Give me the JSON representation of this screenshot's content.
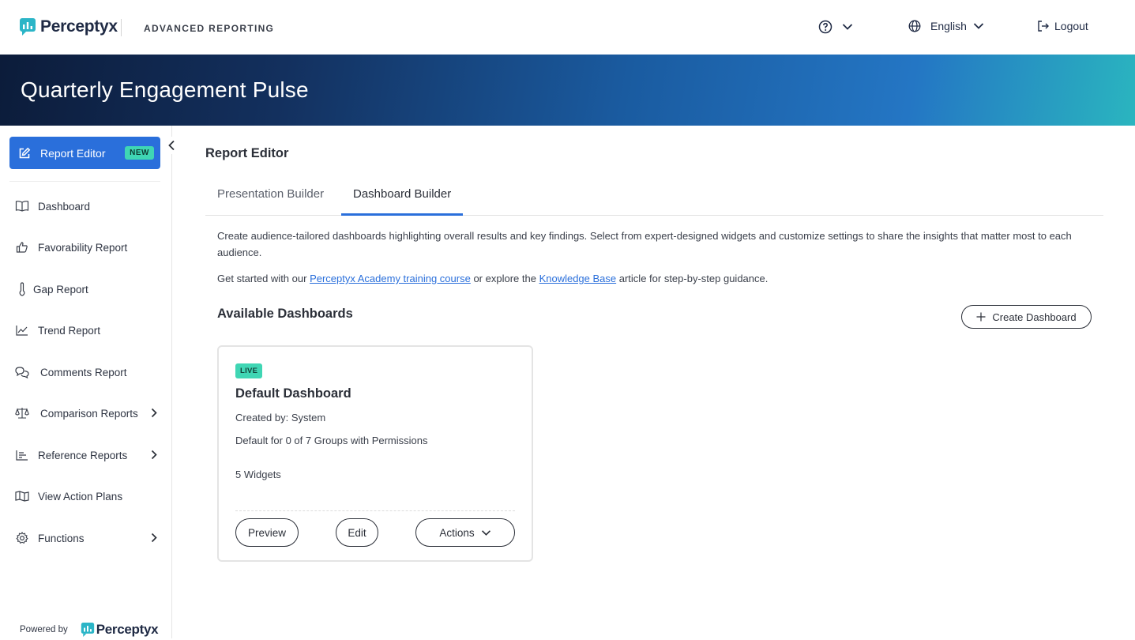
{
  "header": {
    "brand": "Perceptyx",
    "product": "ADVANCED REPORTING",
    "language": "English",
    "logout": "Logout"
  },
  "banner": {
    "title": "Quarterly Engagement Pulse"
  },
  "sidebar": {
    "active": {
      "label": "Report Editor",
      "badge": "NEW"
    },
    "items": [
      {
        "label": "Dashboard",
        "icon": "book-icon"
      },
      {
        "label": "Favorability Report",
        "icon": "thumbs-up-icon"
      },
      {
        "label": "Gap Report",
        "icon": "thermometer-icon"
      },
      {
        "label": "Trend Report",
        "icon": "line-chart-icon"
      },
      {
        "label": "Comments Report",
        "icon": "chat-bubbles-icon"
      },
      {
        "label": "Comparison Reports",
        "icon": "scale-icon"
      },
      {
        "label": "Reference Reports",
        "icon": "bar-list-icon"
      },
      {
        "label": "View Action Plans",
        "icon": "map-icon"
      },
      {
        "label": "Functions",
        "icon": "gear-icon"
      }
    ],
    "powered_by": "Powered by",
    "powered_brand": "Perceptyx"
  },
  "main": {
    "title": "Report Editor",
    "tabs": [
      {
        "label": "Presentation Builder"
      },
      {
        "label": "Dashboard Builder"
      }
    ],
    "description": "Create audience-tailored dashboards highlighting overall results and key findings. Select from expert-designed widgets and customize settings to share the insights that matter most to each audience.",
    "guide": {
      "prefix": "Get started with our ",
      "link1": "Perceptyx Academy training course",
      "middle": " or explore the ",
      "link2": "Knowledge Base",
      "suffix": " article for step-by-step guidance."
    },
    "available_title": "Available Dashboards",
    "create_label": "Create Dashboard",
    "card": {
      "status": "LIVE",
      "title": "Default Dashboard",
      "created_by": "Created by: System",
      "default_for": "Default for 0 of 7 Groups with Permissions",
      "widgets": "5 Widgets",
      "preview": "Preview",
      "edit": "Edit",
      "actions": "Actions"
    }
  },
  "colors": {
    "accent": "#2a6fdb",
    "badge": "#3fd6b4",
    "banner_start": "#0c1c3a",
    "banner_end": "#2ab5bf"
  }
}
